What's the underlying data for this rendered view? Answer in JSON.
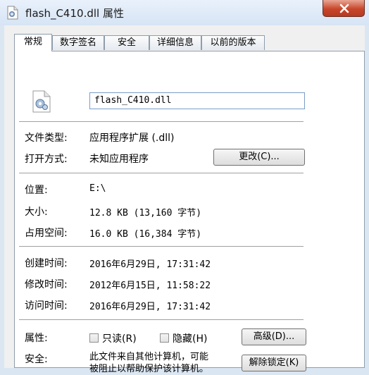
{
  "window": {
    "title": "flash_C410.dll 属性"
  },
  "tabs": [
    {
      "label": "常规"
    },
    {
      "label": "数字签名"
    },
    {
      "label": "安全"
    },
    {
      "label": "详细信息"
    },
    {
      "label": "以前的版本"
    }
  ],
  "file": {
    "name": "flash_C410.dll"
  },
  "general": {
    "type_label": "文件类型:",
    "type_value": "应用程序扩展 (.dll)",
    "open_with_label": "打开方式:",
    "open_with_value": "未知应用程序",
    "change_button": "更改(C)...",
    "location_label": "位置:",
    "location_value": "E:\\",
    "size_label": "大小:",
    "size_value": "12.8 KB (13,160 字节)",
    "size_on_disk_label": "占用空间:",
    "size_on_disk_value": "16.0 KB (16,384 字节)",
    "created_label": "创建时间:",
    "created_value": "2016年6月29日, 17:31:42",
    "modified_label": "修改时间:",
    "modified_value": "2012年6月15日, 11:58:22",
    "accessed_label": "访问时间:",
    "accessed_value": "2016年6月29日, 17:31:42",
    "attributes_label": "属性:",
    "readonly_label": "只读(R)",
    "hidden_label": "隐藏(H)",
    "advanced_button": "高级(D)...",
    "security_label": "安全:",
    "security_text_1": "此文件来自其他计算机，可能",
    "security_text_2": "被阻止以帮助保护该计算机。",
    "unblock_button": "解除锁定(K)"
  },
  "icons": {
    "title": "dll-file-icon",
    "file": "dll-file-icon",
    "close": "close-icon"
  },
  "colors": {
    "close_button": "#c8462b",
    "title_bar": "#dbe6f3",
    "input_border": "#7a9cc9"
  }
}
